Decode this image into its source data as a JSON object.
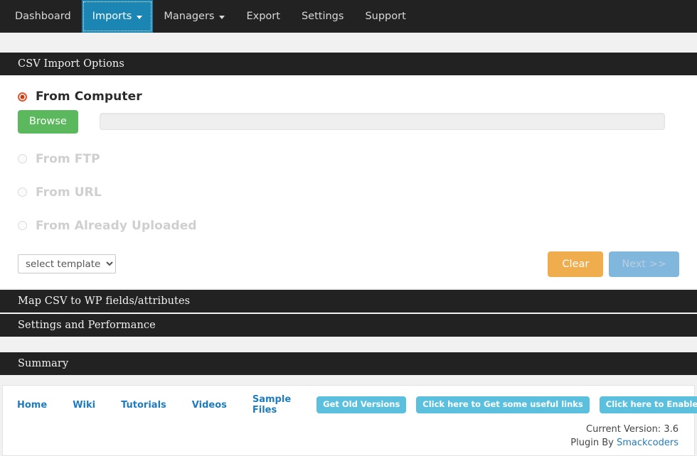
{
  "nav": {
    "items": [
      {
        "label": "Dashboard",
        "active": false,
        "caret": false
      },
      {
        "label": "Imports",
        "active": true,
        "caret": true
      },
      {
        "label": "Managers",
        "active": false,
        "caret": true
      },
      {
        "label": "Export",
        "active": false,
        "caret": false
      },
      {
        "label": "Settings",
        "active": false,
        "caret": false
      },
      {
        "label": "Support",
        "active": false,
        "caret": false
      }
    ]
  },
  "sections": {
    "csv_import_options": "CSV Import Options",
    "map_csv": "Map CSV to WP fields/attributes",
    "settings_performance": "Settings and Performance",
    "summary": "Summary"
  },
  "import_options": {
    "from_computer": {
      "label": "From Computer",
      "selected": true,
      "disabled": false
    },
    "from_ftp": {
      "label": "From FTP",
      "selected": false,
      "disabled": true
    },
    "from_url": {
      "label": "From URL",
      "selected": false,
      "disabled": true
    },
    "from_already_uploaded": {
      "label": "From Already Uploaded",
      "selected": false,
      "disabled": true
    },
    "browse_label": "Browse",
    "file_value": "",
    "file_placeholder": ""
  },
  "controls": {
    "template_select": {
      "selected": "select template",
      "options": [
        "select template"
      ]
    },
    "clear_label": "Clear",
    "next_label": "Next >>",
    "next_disabled": true
  },
  "footer": {
    "links": [
      {
        "label": "Home"
      },
      {
        "label": "Wiki"
      },
      {
        "label": "Tutorials"
      },
      {
        "label": "Videos"
      },
      {
        "label": "Sample Files"
      }
    ],
    "badges": [
      {
        "label": "Get Old Versions"
      },
      {
        "label": "Click here to Get some useful links"
      },
      {
        "label": "Click here to Enable any disabled module"
      }
    ],
    "version_text": "Current Version: 3.6",
    "plugin_by_prefix": "Plugin By ",
    "plugin_by_name": "Smackcoders"
  },
  "colors": {
    "nav_bg": "#222222",
    "nav_active": "#1b86b4",
    "page_bg": "#f1f1f1",
    "browse_green": "#5cb85c",
    "clear_orange": "#f0ad4e",
    "next_blue": "#81b6dd",
    "badge_blue": "#5bc0de",
    "link_blue": "#1f7bbf",
    "radio_orange": "#e2572b"
  }
}
